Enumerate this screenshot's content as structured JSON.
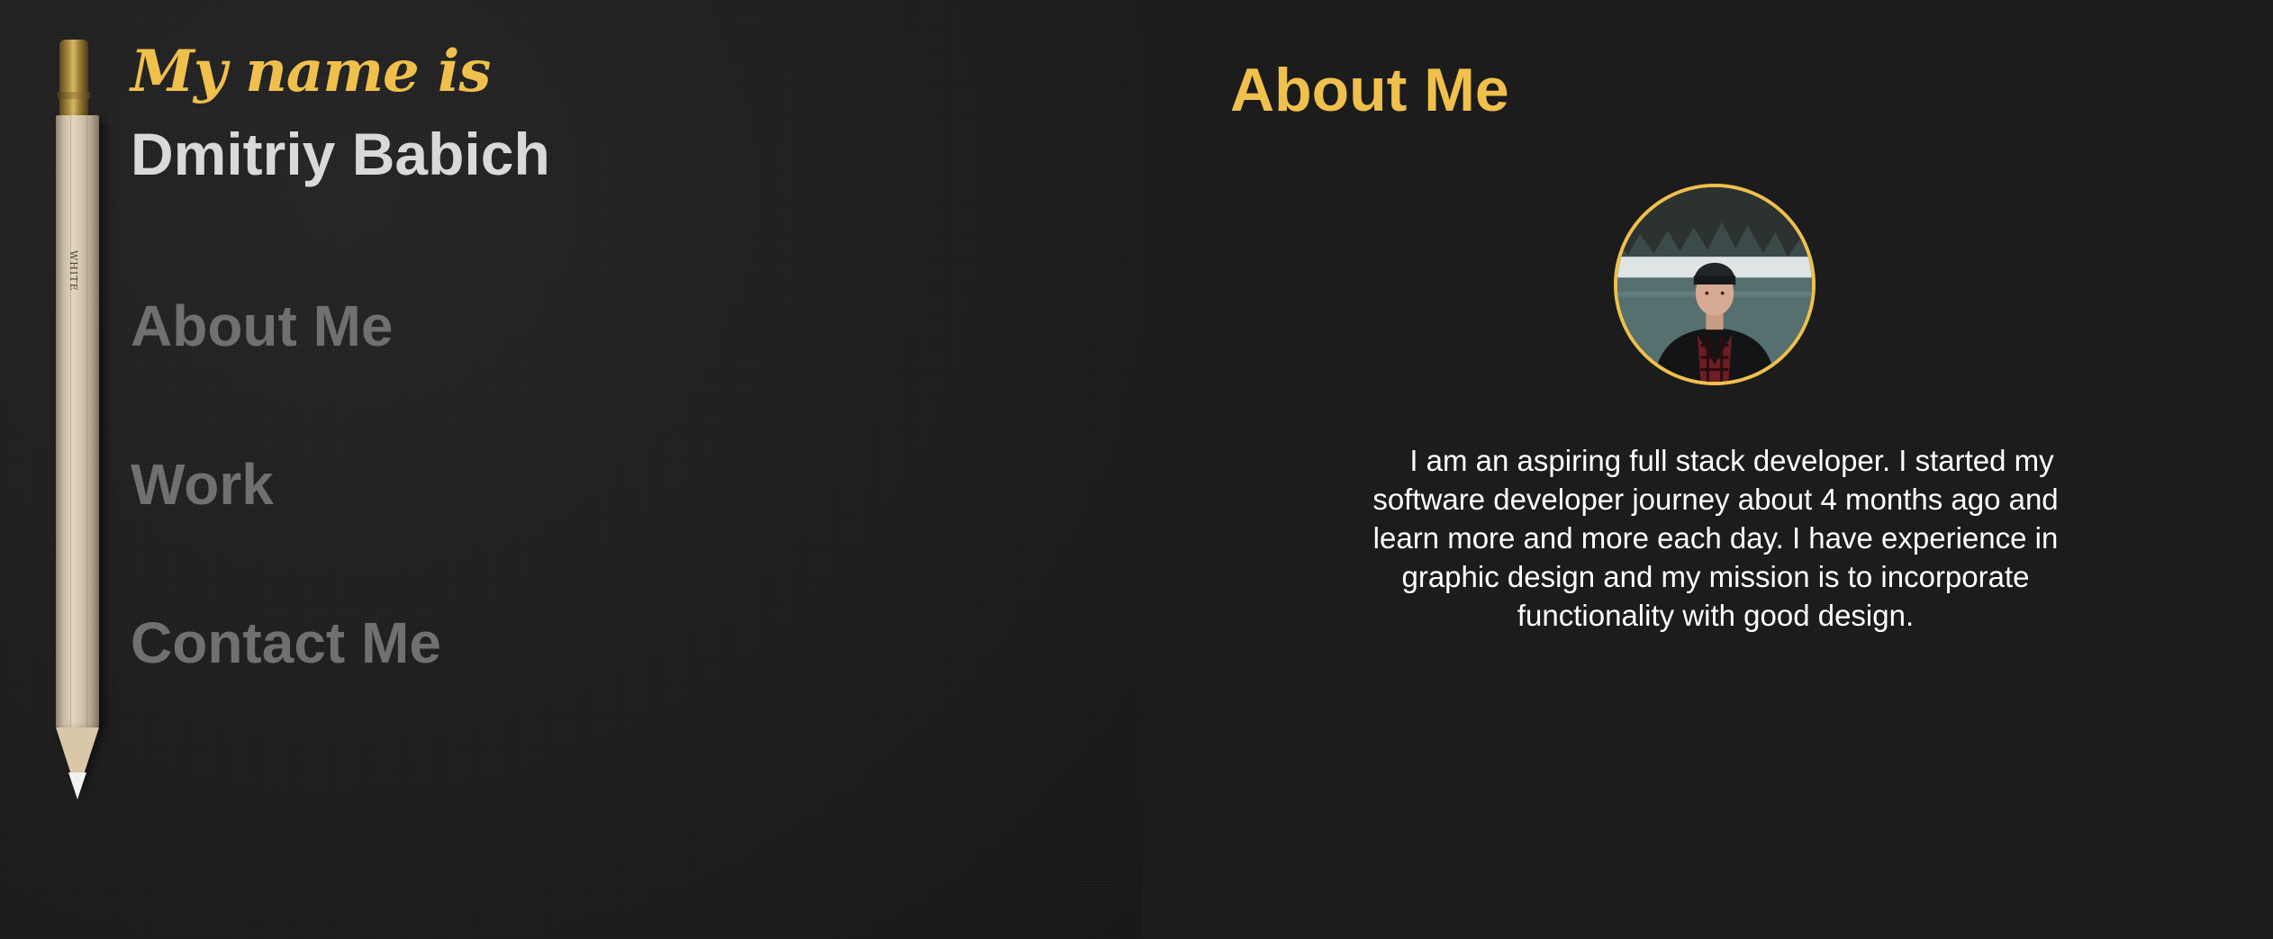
{
  "intro": {
    "kicker": "My name is",
    "name": "Dmitriy Babich"
  },
  "nav": {
    "items": [
      {
        "label": "About Me"
      },
      {
        "label": "Work"
      },
      {
        "label": "Contact Me"
      }
    ]
  },
  "pencil": {
    "brand_text": "WHITE"
  },
  "about": {
    "title": "About Me",
    "bio": "I am an aspiring full stack developer. I started my software developer journey about 4 months ago and learn more and more each day. I have experience in graphic design and my mission is to incorporate functionality with good design."
  },
  "colors": {
    "accent": "#f0c04c",
    "name_text": "#d9d9d9",
    "nav_text": "#707070",
    "background": "#1c1c1c"
  }
}
